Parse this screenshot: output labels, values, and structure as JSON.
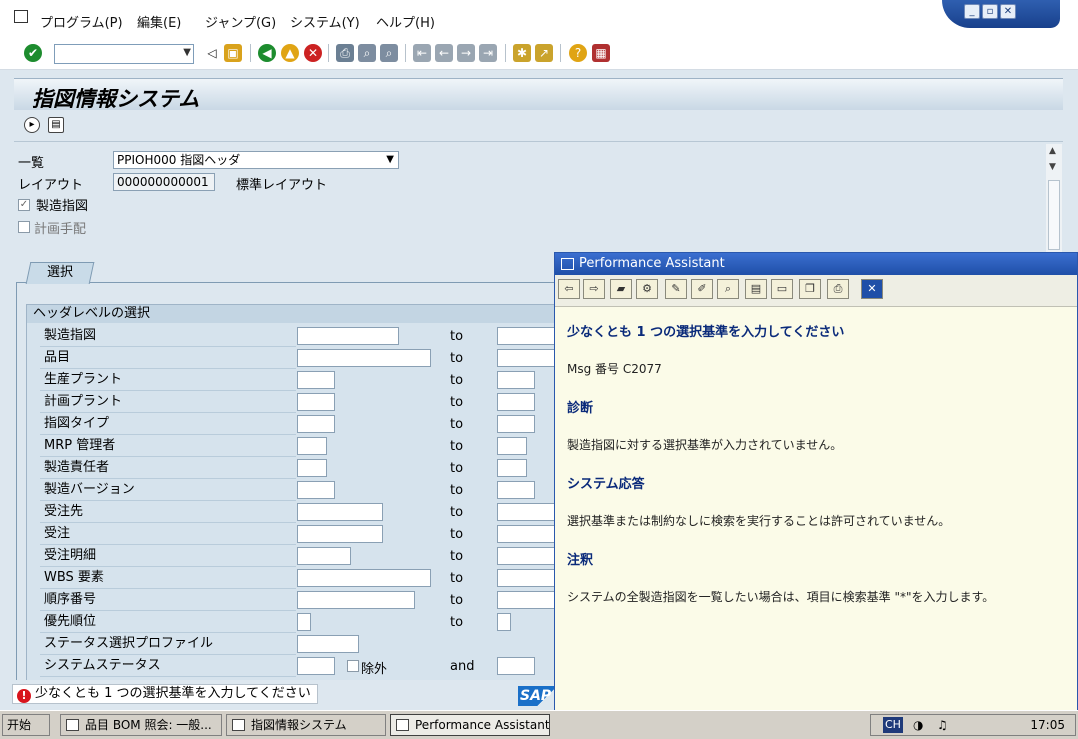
{
  "menubar": {
    "items": [
      "プログラム(P)",
      "編集(E)",
      "ジャンプ(G)",
      "システム(Y)",
      "ヘルプ(H)"
    ]
  },
  "toolbar": {
    "command_value": "",
    "icons": [
      "enter-icon",
      "save-icon",
      "back-icon",
      "exit-icon",
      "cancel-icon",
      "print-icon",
      "find-icon",
      "find-next-icon",
      "first-page-icon",
      "prev-page-icon",
      "next-page-icon",
      "last-page-icon",
      "new-session-icon",
      "shortcut-icon",
      "help-icon",
      "layout-icon"
    ]
  },
  "main": {
    "title": "指図情報システム",
    "fields": {
      "list_label": "一覧",
      "list_value": "PPIOH000 指図ヘッダ",
      "layout_label": "レイアウト",
      "layout_value": "000000000001",
      "layout_desc": "標準レイアウト",
      "prod_order_label": "製造指図",
      "planned_order_label": "計画手配"
    },
    "tab": "選択",
    "group_title": "ヘッダレベルの選択",
    "rows": [
      {
        "label": "製造指図",
        "to": "to"
      },
      {
        "label": "品目",
        "to": "to"
      },
      {
        "label": "生産プラント",
        "to": "to"
      },
      {
        "label": "計画プラント",
        "to": "to"
      },
      {
        "label": "指図タイプ",
        "to": "to"
      },
      {
        "label": "MRP 管理者",
        "to": "to"
      },
      {
        "label": "製造責任者",
        "to": "to"
      },
      {
        "label": "製造バージョン",
        "to": "to"
      },
      {
        "label": "受注先",
        "to": "to"
      },
      {
        "label": "受注",
        "to": "to"
      },
      {
        "label": "受注明細",
        "to": "to"
      },
      {
        "label": "WBS 要素",
        "to": "to"
      },
      {
        "label": "順序番号",
        "to": "to"
      },
      {
        "label": "優先順位",
        "to": "to"
      },
      {
        "label": "ステータス選択プロファイル",
        "to": ""
      },
      {
        "label": "システムステータス",
        "to": "and"
      }
    ],
    "exclude_label": "除外",
    "status_message": "少なくとも 1 つの選択基準を入力してください",
    "sap_logo": "SAP"
  },
  "assistant": {
    "title": "Performance Assistant",
    "heading": "少なくとも 1 つの選択基準を入力してください",
    "msg_number": "Msg 番号  C2077",
    "diag_heading": "診断",
    "diag_text": "製造指図に対する選択基準が入力されていません。",
    "resp_heading": "システム応答",
    "resp_text": "選択基準または制約なしに検索を実行することは許可されていません。",
    "note_heading": "注釈",
    "note_text": "システムの全製造指図を一覧したい場合は、項目に検索基準 \"*\"を入力します。"
  },
  "taskbar": {
    "start": "开始",
    "tasks": [
      "品目 BOM 照会: 一般...",
      "指図情報システム",
      "Performance Assistant"
    ],
    "tray_text": "CH",
    "clock": "17:05"
  },
  "colors": {
    "title_blue": "#1f4fa8",
    "sap_bg": "#dde7ef",
    "assistant_bg": "#fbfbe8"
  }
}
